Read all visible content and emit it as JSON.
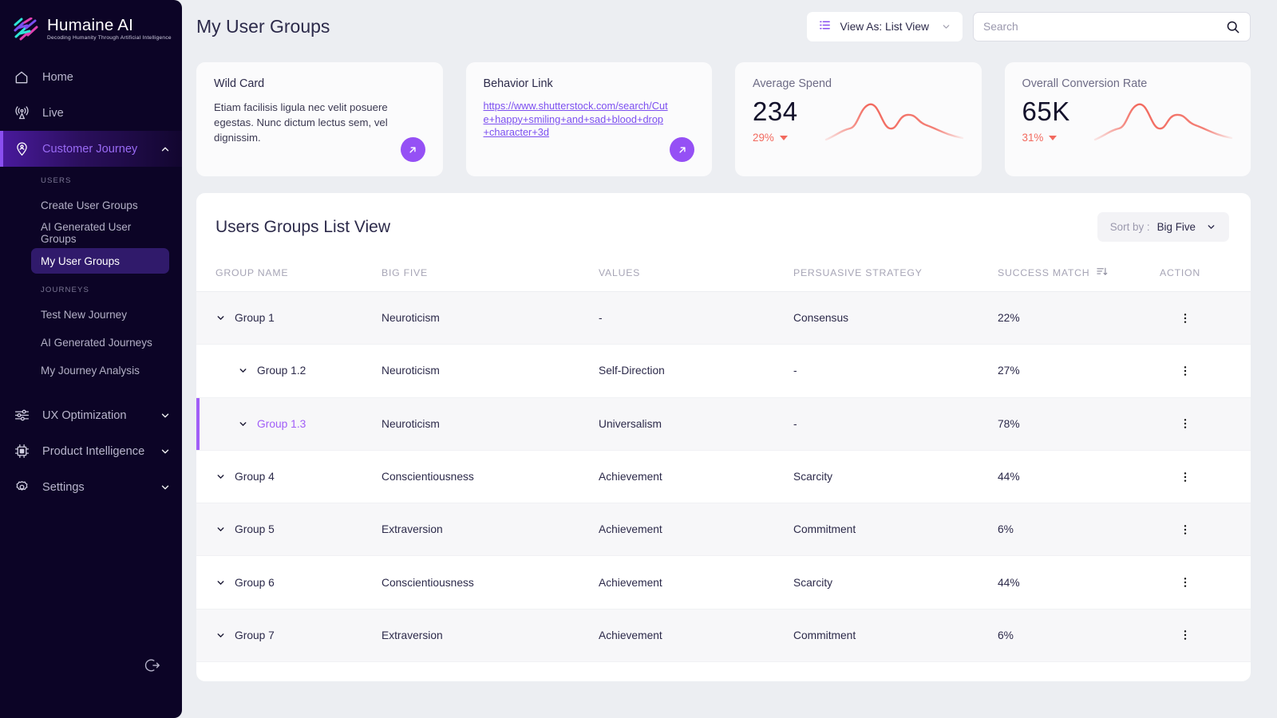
{
  "brand": {
    "title": "Humaine AI",
    "tagline": "Decoding Humanity Through Artificial Intelligence",
    "accent": "#8a4ff0"
  },
  "sidebar": {
    "items": [
      {
        "label": "Home",
        "icon": "home-icon"
      },
      {
        "label": "Live",
        "icon": "broadcast-icon"
      },
      {
        "label": "Customer Journey",
        "icon": "location-pin-user-icon",
        "expanded": true,
        "active": true
      }
    ],
    "users_section_label": "USERS",
    "users_items": [
      {
        "label": "Create User Groups"
      },
      {
        "label": "AI Generated User Groups"
      },
      {
        "label": "My User Groups",
        "current": true
      }
    ],
    "journeys_section_label": "JOURNEYS",
    "journeys_items": [
      {
        "label": "Test New Journey"
      },
      {
        "label": "AI Generated Journeys"
      },
      {
        "label": "My Journey Analysis"
      }
    ],
    "bottom_items": [
      {
        "label": "UX Optimization",
        "icon": "sliders-icon"
      },
      {
        "label": "Product Intelligence",
        "icon": "chip-icon"
      },
      {
        "label": "Settings",
        "icon": "gear-icon"
      }
    ],
    "logout_icon": "logout-icon"
  },
  "header": {
    "page_title": "My User Groups",
    "view_as_label": "View As: List View",
    "view_as_icon": "list-icon",
    "search_placeholder": "Search",
    "search_value": "",
    "search_icon": "search-icon"
  },
  "cards": {
    "wild_card": {
      "title": "Wild Card",
      "body": "Etiam facilisis ligula nec velit posuere egestas. Nunc dictum lectus sem, vel dignissim.",
      "action_icon": "arrow-up-right-icon"
    },
    "behavior_link": {
      "title": "Behavior Link",
      "url": "https://www.shutterstock.com/search/Cute+happy+smiling+and+sad+blood+drop+character+3d",
      "action_icon": "arrow-up-right-icon"
    },
    "average_spend": {
      "title": "Average Spend",
      "value": "234",
      "delta": "29%",
      "delta_direction": "down",
      "delta_color": "#f2695e"
    },
    "conversion_rate": {
      "title": "Overall Conversion Rate",
      "value": "65K",
      "delta": "31%",
      "delta_direction": "down",
      "delta_color": "#f2695e"
    }
  },
  "table_panel": {
    "title": "Users Groups List View",
    "sort_by_prefix": "Sort by :",
    "sort_by_value": "Big Five",
    "columns": [
      "GROUP NAME",
      "BIG FIVE",
      "VALUES",
      "PERSUASIVE STRATEGY",
      "SUCCESS MATCH",
      "ACTION"
    ],
    "success_match_sort_icon": "sort-descending-icon",
    "rows": [
      {
        "name": "Group 1",
        "level": 0,
        "big_five": "Neuroticism",
        "values": "-",
        "strategy": "Consensus",
        "success": "22%",
        "highlight": false,
        "selected": false,
        "shade": true
      },
      {
        "name": "Group 1.2",
        "level": 1,
        "big_five": "Neuroticism",
        "values": "Self-Direction",
        "strategy": "-",
        "success": "27%",
        "highlight": false,
        "selected": false,
        "shade": false
      },
      {
        "name": "Group 1.3",
        "level": 1,
        "big_five": "Neuroticism",
        "values": "Universalism",
        "strategy": "-",
        "success": "78%",
        "highlight": true,
        "selected": true,
        "shade": true
      },
      {
        "name": "Group 4",
        "level": 0,
        "big_five": "Conscientiousness",
        "values": "Achievement",
        "strategy": "Scarcity",
        "success": "44%",
        "highlight": false,
        "selected": false,
        "shade": false
      },
      {
        "name": "Group 5",
        "level": 0,
        "big_five": "Extraversion",
        "values": "Achievement",
        "strategy": "Commitment",
        "success": "6%",
        "highlight": false,
        "selected": false,
        "shade": true
      },
      {
        "name": "Group 6",
        "level": 0,
        "big_five": "Conscientiousness",
        "values": "Achievement",
        "strategy": "Scarcity",
        "success": "44%",
        "highlight": false,
        "selected": false,
        "shade": false
      },
      {
        "name": "Group 7",
        "level": 0,
        "big_five": "Extraversion",
        "values": "Achievement",
        "strategy": "Commitment",
        "success": "6%",
        "highlight": false,
        "selected": false,
        "shade": true
      }
    ],
    "row_action_icon": "kebab-menu-icon",
    "row_expand_icon": "chevron-down-icon"
  }
}
